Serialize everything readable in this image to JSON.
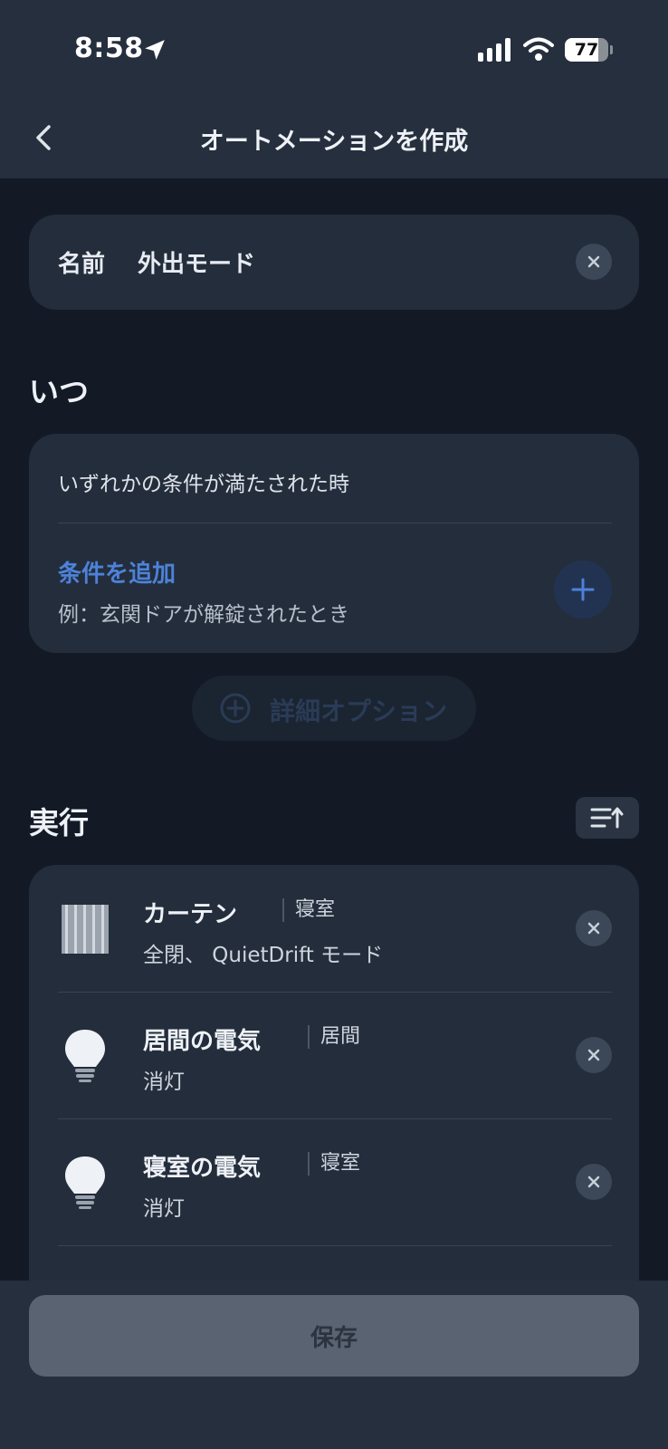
{
  "status_bar": {
    "time": "8:58",
    "battery_percent": "77",
    "battery_level": 0.77,
    "icons": [
      "location-arrow-icon",
      "signal-bars-icon",
      "wifi-icon",
      "battery-icon"
    ]
  },
  "header": {
    "title": "オートメーションを作成",
    "back_icon": "chevron-left-icon"
  },
  "name_field": {
    "label": "名前",
    "value": "外出モード",
    "clear_icon": "close-icon"
  },
  "when_section": {
    "title": "いつ",
    "condition_mode": "いずれかの条件が満たされた時",
    "add_condition": {
      "label": "条件を追加",
      "example": "例：玄関ドアが解錠されたとき",
      "icon": "plus-icon"
    }
  },
  "advanced_options": {
    "label": "詳細オプション",
    "icon": "plus-circle-icon"
  },
  "actions_section": {
    "title": "実行",
    "sort_icon": "sort-icon",
    "items": [
      {
        "title": "カーテン",
        "room": "寝室",
        "description": "全閉、 QuietDrift モード",
        "icon": "curtain-icon"
      },
      {
        "title": "居間の電気",
        "room": "居間",
        "description": "消灯",
        "icon": "lightbulb-icon"
      },
      {
        "title": "寝室の電気",
        "room": "寝室",
        "description": "消灯",
        "icon": "lightbulb-icon"
      }
    ]
  },
  "footer": {
    "save_label": "保存"
  },
  "colors": {
    "background": "#131a26",
    "header": "#252f3e",
    "card": "#232d3c",
    "accent": "#4d82d8",
    "save_button": "#5a6371"
  }
}
